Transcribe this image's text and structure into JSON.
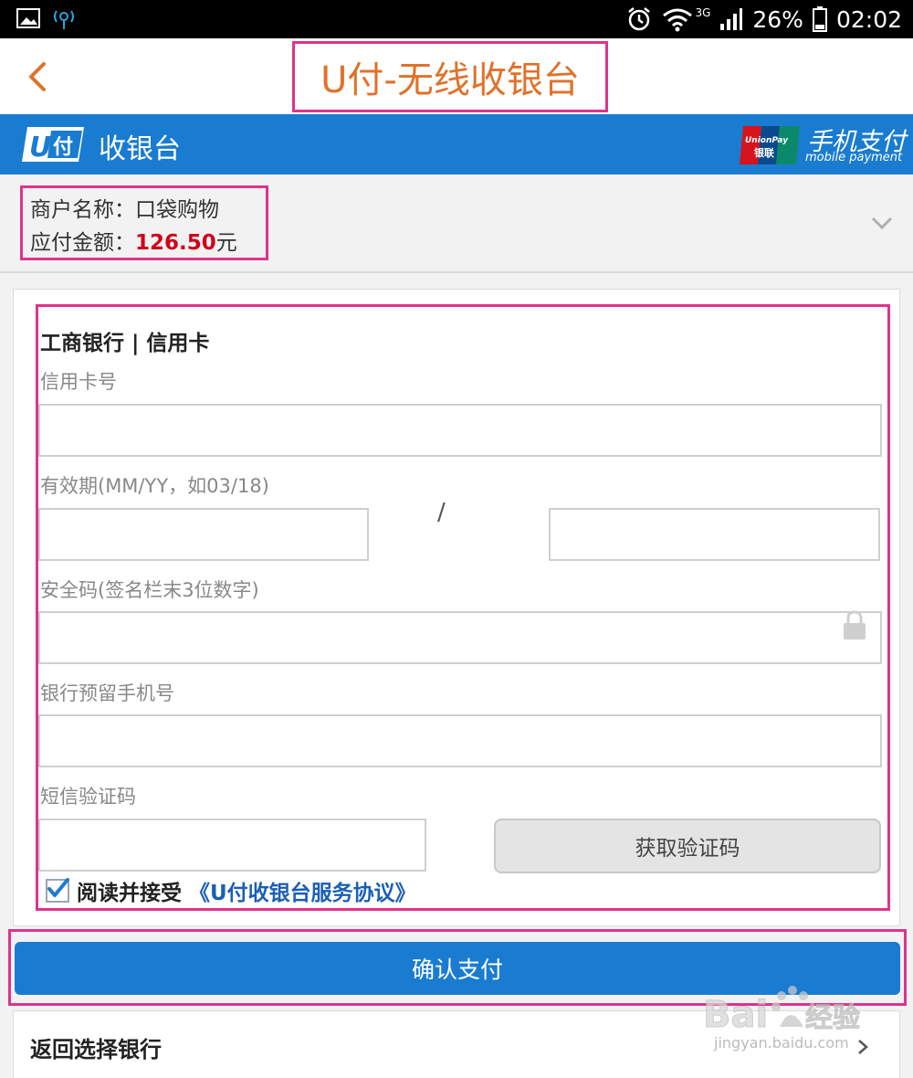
{
  "status_bar": {
    "battery": "26%",
    "time": "02:02",
    "network": "3G"
  },
  "header": {
    "title": "U付-无线收银台",
    "back_icon": "chevron-left-icon"
  },
  "banner": {
    "logo_text": "U付",
    "label": "收银台",
    "unionpay_text": "UnionPay 银联",
    "mobile_pay_cn": "手机支付",
    "mobile_pay_en": "mobile payment"
  },
  "merchant": {
    "name_label": "商户名称：",
    "name_value": "口袋购物",
    "amount_label": "应付金额：",
    "amount_value": "126.50",
    "amount_unit": "元"
  },
  "form": {
    "bank_title": "工商银行 | 信用卡",
    "card_number_label": "信用卡号",
    "card_number_value": "",
    "expiry_label": "有效期(MM/YY，如03/18)",
    "expiry_month_value": "",
    "expiry_separator": "/",
    "expiry_year_value": "",
    "cvv_label": "安全码(签名栏末3位数字)",
    "cvv_value": "",
    "phone_label": "银行预留手机号",
    "phone_value": "",
    "sms_label": "短信验证码",
    "sms_value": "",
    "get_code_button": "获取验证码",
    "agree_text": "阅读并接受",
    "agree_link": "《U付收银台服务协议》",
    "agree_checked": true
  },
  "actions": {
    "confirm_button": "确认支付",
    "back_to_bank": "返回选择银行"
  },
  "watermark": {
    "text": "jingyan.baidu.com"
  },
  "colors": {
    "accent_blue": "#1a7cd0",
    "title_orange": "#e0722a",
    "highlight_pink": "#e0338b",
    "amount_red": "#d0021b"
  }
}
